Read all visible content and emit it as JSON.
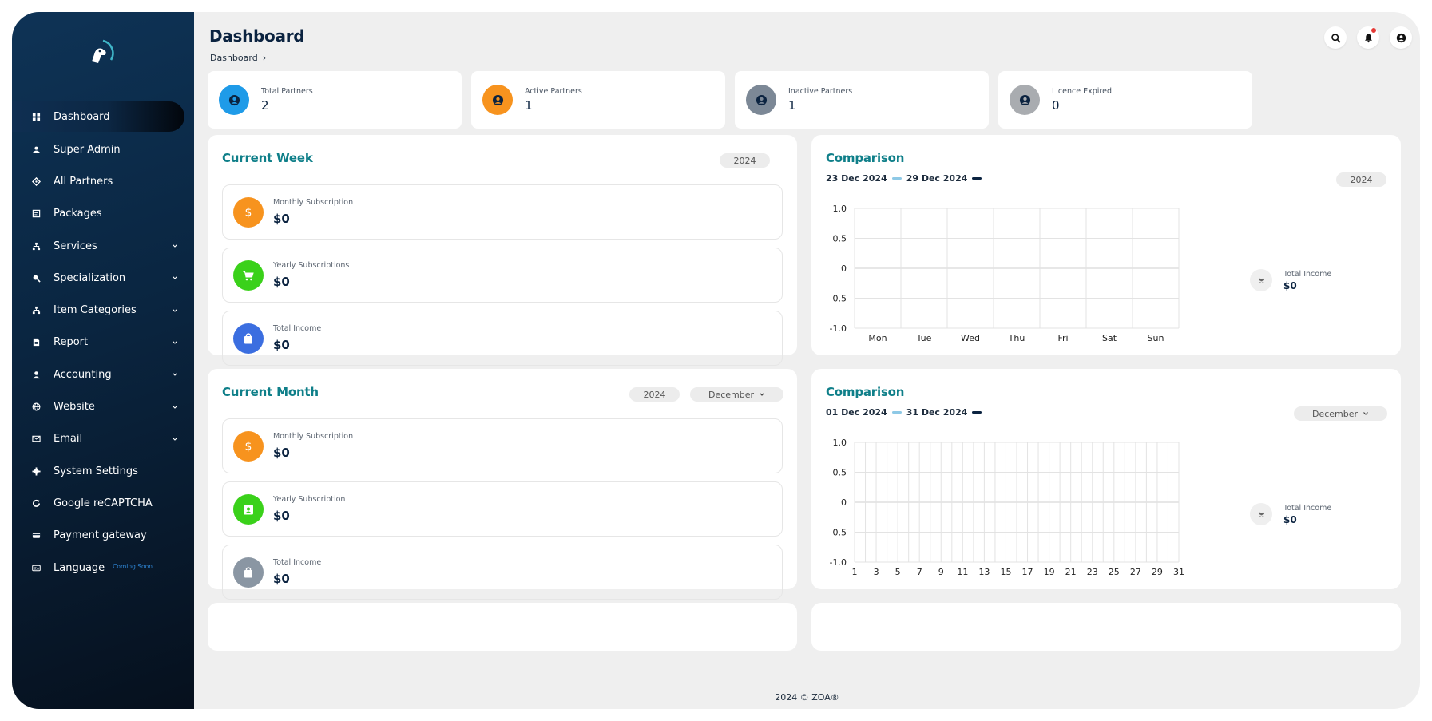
{
  "sidebar": {
    "items": [
      {
        "label": "Dashboard",
        "icon": "grid-icon",
        "active": true,
        "has_chevron": false
      },
      {
        "label": "Super Admin",
        "icon": "user-group-icon",
        "has_chevron": false
      },
      {
        "label": "All Partners",
        "icon": "handshake-icon",
        "has_chevron": false
      },
      {
        "label": "Packages",
        "icon": "package-icon",
        "has_chevron": false
      },
      {
        "label": "Services",
        "icon": "sitemap-icon",
        "has_chevron": true
      },
      {
        "label": "Specialization",
        "icon": "search-tag-icon",
        "has_chevron": true
      },
      {
        "label": "Item Categories",
        "icon": "sitemap-icon",
        "has_chevron": true
      },
      {
        "label": "Report",
        "icon": "file-icon",
        "has_chevron": true
      },
      {
        "label": "Accounting",
        "icon": "user-icon",
        "has_chevron": true
      },
      {
        "label": "Website",
        "icon": "globe-icon",
        "has_chevron": true
      },
      {
        "label": "Email",
        "icon": "envelope-icon",
        "has_chevron": true
      },
      {
        "label": "System Settings",
        "icon": "gear-icon",
        "has_chevron": false
      },
      {
        "label": "Google reCAPTCHA",
        "icon": "refresh-icon",
        "has_chevron": false
      },
      {
        "label": "Payment gateway",
        "icon": "credit-card-icon",
        "has_chevron": false
      },
      {
        "label": "Language",
        "icon": "language-icon",
        "has_chevron": false,
        "badge": "Coming Soon"
      }
    ]
  },
  "header": {
    "title": "Dashboard",
    "breadcrumb": "Dashboard",
    "breadcrumb_sep": "›"
  },
  "stats": [
    {
      "label": "Total Partners",
      "value": "2",
      "color": "#1f9be8"
    },
    {
      "label": "Active Partners",
      "value": "1",
      "color": "#f7931e"
    },
    {
      "label": "Inactive Partners",
      "value": "1",
      "color": "#7c8896"
    },
    {
      "label": "Licence Expired",
      "value": "0",
      "color": "#a9acb0"
    }
  ],
  "week": {
    "title": "Current Week",
    "year": "2024",
    "rows": [
      {
        "label": "Monthly Subscription",
        "value": "$0",
        "color": "#f7931e",
        "icon": "dollar-icon"
      },
      {
        "label": "Yearly Subscriptions",
        "value": "$0",
        "color": "#3ad11a",
        "icon": "cart-icon"
      },
      {
        "label": "Total Income",
        "value": "$0",
        "color": "#3b6ee0",
        "icon": "bag-icon"
      }
    ]
  },
  "month": {
    "title": "Current Month",
    "year": "2024",
    "month": "December",
    "rows": [
      {
        "label": "Monthly Subscription",
        "value": "$0",
        "color": "#f7931e",
        "icon": "dollar-icon"
      },
      {
        "label": "Yearly Subscription",
        "value": "$0",
        "color": "#3ad11a",
        "icon": "calendar-user-icon"
      },
      {
        "label": "Total Income",
        "value": "$0",
        "color": "#8a96a3",
        "icon": "bag-icon"
      }
    ]
  },
  "comparison_week": {
    "title": "Comparison",
    "range_a": "23 Dec 2024",
    "range_b": "29 Dec 2024",
    "year": "2024",
    "income_label": "Total Income",
    "income_value": "$0"
  },
  "comparison_month": {
    "title": "Comparison",
    "range_a": "01 Dec 2024",
    "range_b": "31 Dec 2024",
    "month": "December",
    "income_label": "Total Income",
    "income_value": "$0"
  },
  "colors": {
    "series_a": "#8ec9e6",
    "series_b": "#0b2340",
    "accent": "#0f7f89"
  },
  "footer": "2024 © ZOA®",
  "chart_data": [
    {
      "type": "line",
      "title": "",
      "categories": [
        "Mon",
        "Tue",
        "Wed",
        "Thu",
        "Fri",
        "Sat",
        "Sun"
      ],
      "yticks": [
        "1.0",
        "0.5",
        "0",
        "-0.5",
        "-1.0"
      ],
      "ylim": [
        -1,
        1
      ],
      "grid": true,
      "series": []
    },
    {
      "type": "line",
      "title": "",
      "categories": [
        "1",
        "3",
        "5",
        "7",
        "9",
        "11",
        "13",
        "15",
        "17",
        "19",
        "21",
        "23",
        "25",
        "27",
        "29",
        "31"
      ],
      "yticks": [
        "1.0",
        "0.5",
        "0",
        "-0.5",
        "-1.0"
      ],
      "ylim": [
        -1,
        1
      ],
      "grid": true,
      "series": []
    }
  ]
}
